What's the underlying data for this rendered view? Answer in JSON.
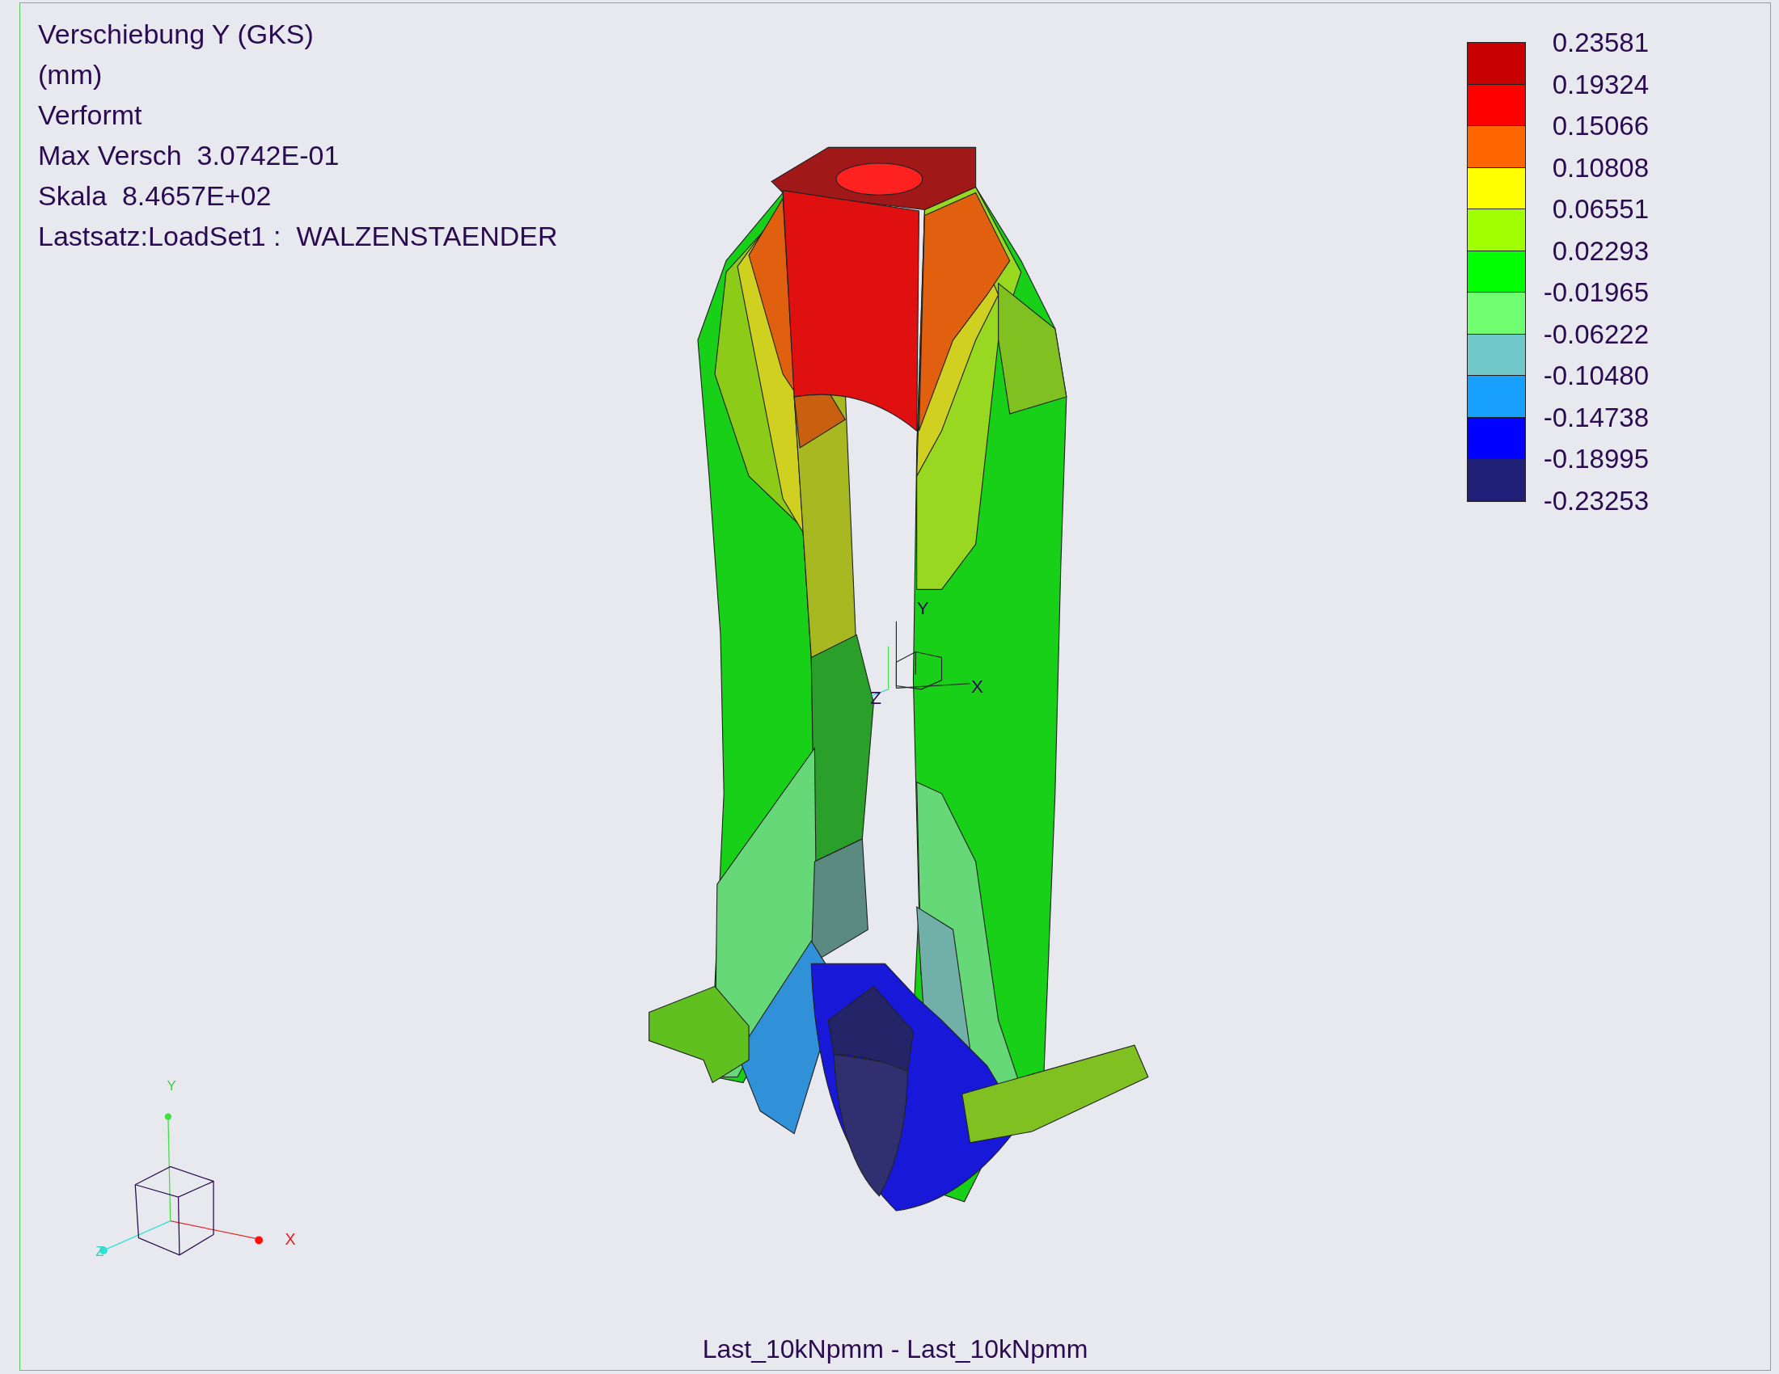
{
  "info_lines": [
    "Verschiebung Y (GKS)",
    "(mm)",
    "Verformt",
    "Max Versch  3.0742E-01",
    "Skala  8.4657E+02",
    "Lastsatz:LoadSet1 :  WALZENSTAENDER"
  ],
  "legend": {
    "bands": [
      {
        "color": "#c80000"
      },
      {
        "color": "#ff0000"
      },
      {
        "color": "#ff6600"
      },
      {
        "color": "#ffff00"
      },
      {
        "color": "#a0ff00"
      },
      {
        "color": "#00ff00"
      },
      {
        "color": "#70ff70"
      },
      {
        "color": "#70c8c8"
      },
      {
        "color": "#18a0ff"
      },
      {
        "color": "#0000ff"
      },
      {
        "color": "#202078"
      }
    ],
    "labels": [
      "0.23581",
      "0.19324",
      "0.15066",
      "0.10808",
      "0.06551",
      "0.02293",
      "-0.01965",
      "-0.06222",
      "-0.10480",
      "-0.14738",
      "-0.18995",
      "-0.23253"
    ]
  },
  "model_triad": {
    "y_label": "Y",
    "z_label": "Z",
    "x_label": "X"
  },
  "global_triad": {
    "y_label": "Y",
    "x_label": "X",
    "z_label": "Z"
  },
  "caption": "Last_10kNpmm - Last_10kNpmm"
}
